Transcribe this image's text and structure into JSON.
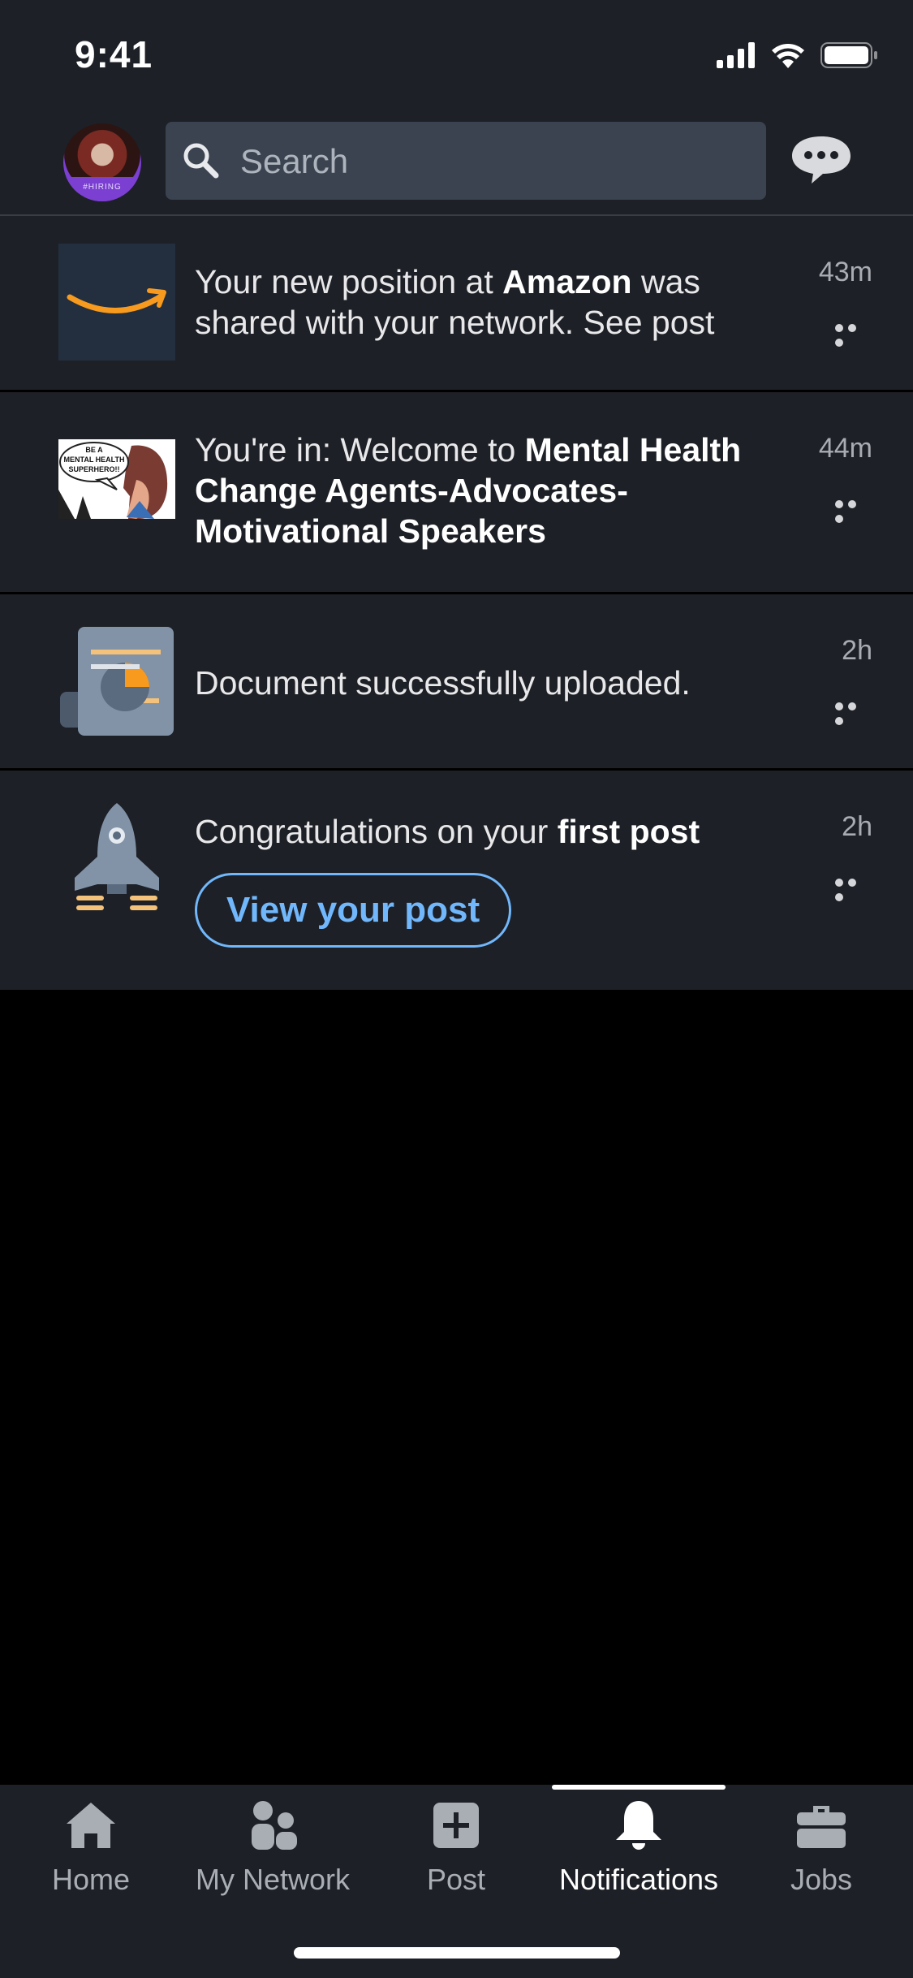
{
  "status_bar": {
    "time": "9:41"
  },
  "header": {
    "avatar_badge": "#HIRING",
    "search_placeholder": "Search"
  },
  "notifications": [
    {
      "text_parts": [
        "Your new position at ",
        "Amazon",
        " was shared with your network. See post"
      ],
      "time": "43m"
    },
    {
      "image_caption": "BE A MENTAL HEALTH SUPERHERO!!",
      "text_parts": [
        "You're in: Welcome to ",
        "Mental Health Change Agents-Advocates-Motivational Speakers"
      ],
      "time": "44m"
    },
    {
      "text": "Document successfully uploaded.",
      "time": "2h"
    },
    {
      "text_parts": [
        "Congratulations on your ",
        "first post"
      ],
      "time": "2h",
      "button_label": "View your post"
    }
  ],
  "tabs": [
    {
      "label": "Home",
      "icon": "home-icon"
    },
    {
      "label": "My Network",
      "icon": "network-icon"
    },
    {
      "label": "Post",
      "icon": "post-plus-icon"
    },
    {
      "label": "Notifications",
      "icon": "bell-icon",
      "active": true
    },
    {
      "label": "Jobs",
      "icon": "briefcase-icon"
    }
  ],
  "colors": {
    "surface": "#1d2026",
    "background": "#000000",
    "accent_blue": "#71b7fb",
    "amazon_orange": "#f79a1e"
  }
}
